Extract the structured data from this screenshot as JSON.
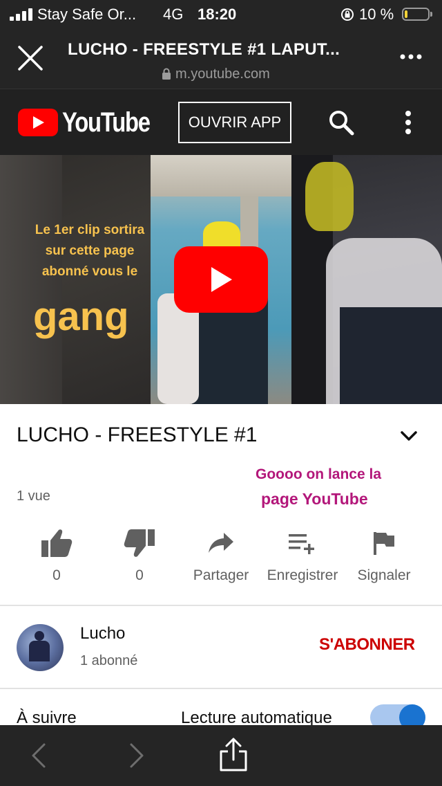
{
  "status_bar": {
    "carrier": "Stay Safe Or...",
    "network": "4G",
    "time": "18:20",
    "battery": "10 %",
    "battery_level": 0.1
  },
  "browser": {
    "page_title": "LUCHO - FREESTYLE #1 LAPUT...",
    "url": "m.youtube.com"
  },
  "youtube_header": {
    "logo_text": "YouTube",
    "open_app_label": "OUVRIR APP"
  },
  "thumbnail": {
    "overlay_lines": [
      "Le 1er clip sortira",
      "sur cette page",
      "abonné vous le"
    ],
    "overlay_big": "gang"
  },
  "video": {
    "title": "LUCHO - FREESTYLE #1",
    "views": "1 vue",
    "comment_lines": [
      "Goooo on lance la",
      "page YouTube"
    ]
  },
  "actions": [
    {
      "icon": "thumbs-up-icon",
      "label": "0"
    },
    {
      "icon": "thumbs-down-icon",
      "label": "0"
    },
    {
      "icon": "share-icon",
      "label": "Partager"
    },
    {
      "icon": "save-playlist-icon",
      "label": "Enregistrer"
    },
    {
      "icon": "flag-icon",
      "label": "Signaler"
    }
  ],
  "channel": {
    "name": "Lucho",
    "subscribers": "1 abonné",
    "subscribe_label": "S'ABONNER"
  },
  "up_next": {
    "label": "À suivre",
    "autoplay_label": "Lecture automatique",
    "autoplay_on": true
  },
  "colors": {
    "youtube_red": "#ff0000",
    "subscribe_red": "#cc0000",
    "overlay_yellow": "#f7c24e",
    "comment_magenta": "#b3177a",
    "toggle_blue": "#1a73d0"
  }
}
